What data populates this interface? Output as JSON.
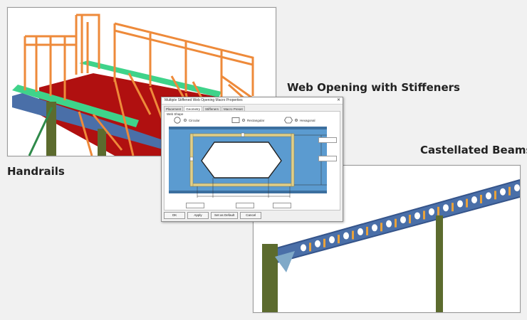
{
  "labels": {
    "handrails": "Handrails",
    "web_opening": "Web Opening with Stiffeners",
    "castellated": "Castellated Beams"
  },
  "dialog": {
    "title": "Multiple Stiffened Web Opening Macro Properties",
    "tabs": [
      "Placement",
      "Geometry",
      "Stiffeners",
      "Macro Preset"
    ],
    "active_tab": "Geometry",
    "group_label": "Web Shape",
    "shape_options": [
      {
        "label": "Circular",
        "selected": false
      },
      {
        "label": "Rectangular",
        "selected": false
      },
      {
        "label": "Hexagonal",
        "selected": true
      }
    ],
    "buttons": {
      "ok": "OK",
      "apply": "Apply",
      "set_default": "Set as Default",
      "cancel": "Cancel"
    }
  },
  "colors": {
    "handrail": "#ee8a3a",
    "deck": "#b01010",
    "green_beam": "#3fd38a",
    "steel_blue": "#4a6fa8",
    "column": "#5c6b2e",
    "stiffener": "#e0cf8a",
    "web_panel": "#5b9bd0"
  }
}
